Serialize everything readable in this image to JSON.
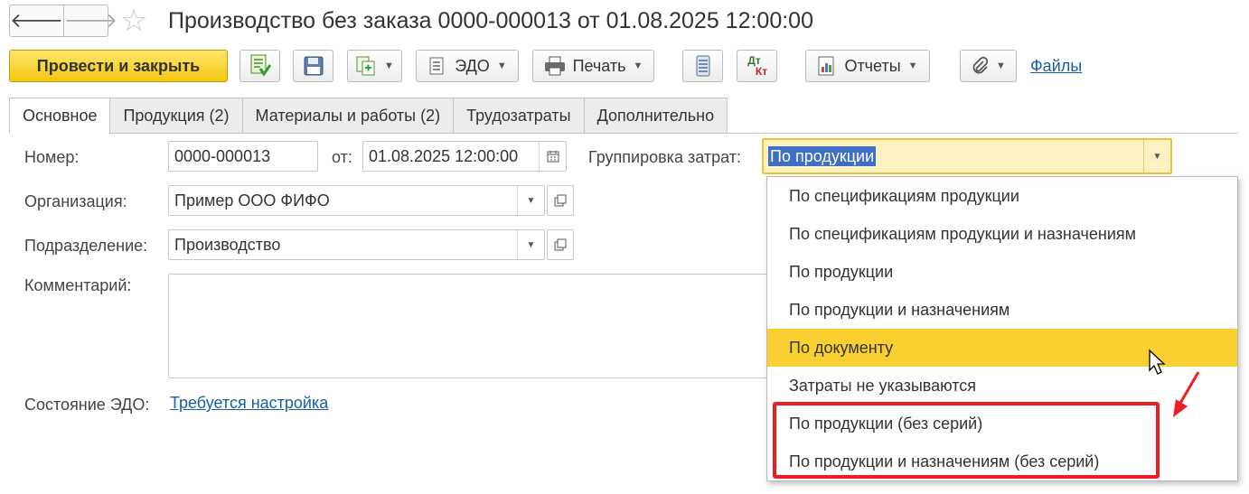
{
  "header": {
    "back_icon": "arrow-left-icon",
    "forward_icon": "arrow-right-icon",
    "favorite_icon": "star-icon",
    "title": "Производство без заказа 0000-000013 от 01.08.2025 12:00:00"
  },
  "toolbar": {
    "post_close_label": "Провести и закрыть",
    "edo_label": "ЭДО",
    "print_label": "Печать",
    "dt_label": "Дт",
    "kt_label": "Кт",
    "reports_label": "Отчеты",
    "files_label": "Файлы"
  },
  "tabs": [
    {
      "label": "Основное",
      "active": true
    },
    {
      "label": "Продукция (2)",
      "active": false
    },
    {
      "label": "Материалы и работы (2)",
      "active": false
    },
    {
      "label": "Трудозатраты",
      "active": false
    },
    {
      "label": "Дополнительно",
      "active": false
    }
  ],
  "form": {
    "number_label": "Номер:",
    "number_value": "0000-000013",
    "date_label": "от:",
    "date_value": "01.08.2025 12:00:00",
    "grouping_label": "Группировка затрат:",
    "grouping_value": "По продукции",
    "org_label": "Организация:",
    "org_value": "Пример ООО ФИФО",
    "dept_label": "Подразделение:",
    "dept_value": "Производство",
    "comment_label": "Комментарий:",
    "comment_value": "",
    "edo_status_label": "Состояние ЭДО:",
    "edo_status_link": "Требуется настройка"
  },
  "dropdown": {
    "items": [
      {
        "label": "По спецификациям продукции",
        "highlighted": false
      },
      {
        "label": "По спецификациям продукции и назначениям",
        "highlighted": false
      },
      {
        "label": "По продукции",
        "highlighted": false
      },
      {
        "label": "По продукции и назначениям",
        "highlighted": false
      },
      {
        "label": "По документу",
        "highlighted": true
      },
      {
        "label": "Затраты не указываются",
        "highlighted": false
      },
      {
        "label": "По продукции (без серий)",
        "highlighted": false
      },
      {
        "label": "По продукции и назначениям (без серий)",
        "highlighted": false
      }
    ]
  },
  "colors": {
    "accent_yellow": "#f9d02f",
    "selection_blue": "#3f6fc6",
    "annotation_red": "#ee1c23",
    "link_blue": "#1a5ea8"
  }
}
